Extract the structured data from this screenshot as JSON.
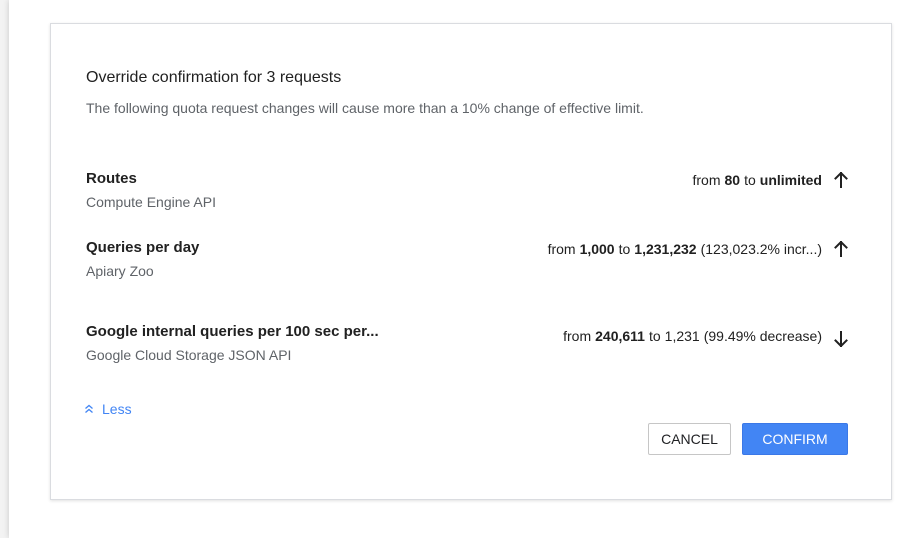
{
  "dialog": {
    "title": "Override confirmation for 3 requests",
    "subtitle": "The following quota request changes will cause more than a 10% change of effective limit.",
    "rows": [
      {
        "name": "Routes",
        "service": "Compute Engine API",
        "from_word": "from",
        "from_value": "80",
        "to_word": "to",
        "to_value": "unlimited",
        "note": "",
        "direction_icon": "arrow-up-icon"
      },
      {
        "name": "Queries per day",
        "service": "Apiary Zoo",
        "from_word": "from",
        "from_value": "1,000",
        "to_word": "to",
        "to_value": "1,231,232",
        "note": "(123,023.2% incr...)",
        "direction_icon": "arrow-up-icon"
      },
      {
        "name": "Google internal queries per 100 sec per...",
        "service": "Google Cloud Storage JSON API",
        "from_word": "from",
        "from_value": "240,611",
        "to_word": "to",
        "to_value": "1,231",
        "note": "(99.49% decrease)",
        "direction_icon": "arrow-down-icon"
      }
    ],
    "less_label": "Less",
    "cancel_label": "CANCEL",
    "confirm_label": "CONFIRM"
  },
  "colors": {
    "accent": "#4285f4",
    "secondary_text": "#5f6368",
    "primary_text": "#212121"
  }
}
